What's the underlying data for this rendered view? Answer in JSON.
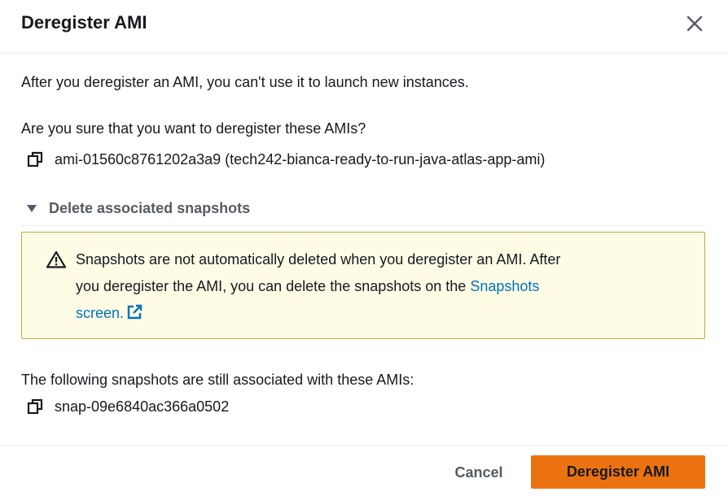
{
  "modal": {
    "title": "Deregister AMI",
    "close_icon": "close-icon"
  },
  "body": {
    "intro": "After you deregister an AMI, you can't use it to launch new instances.",
    "confirm_question": "Are you sure that you want to deregister these AMIs?",
    "ami_entry": "ami-01560c8761202a3a9 (tech242-bianca-ready-to-run-java-atlas-app-ami)",
    "copy_icon": "copy-icon"
  },
  "expandable": {
    "label": "Delete associated snapshots",
    "expanded": true,
    "caret_icon": "caret-down-icon"
  },
  "alert": {
    "type": "warning",
    "icon": "warning-icon",
    "text_line1": "Snapshots are not automatically deleted when you deregister an AMI. After",
    "text_line2_prefix": "you deregister the AMI, you can delete the snapshots on the",
    "link_text_part1": "Snapshots",
    "link_text_part2": "screen.",
    "external_link_icon": "external-link-icon"
  },
  "snapshots": {
    "heading": "The following snapshots are still associated with these AMIs:",
    "items": [
      "snap-09e6840ac366a0502"
    ]
  },
  "footer": {
    "cancel_label": "Cancel",
    "primary_label": "Deregister AMI"
  },
  "colors": {
    "primary_button": "#ec7211",
    "link": "#0073bb",
    "alert_background": "#fffce6",
    "alert_border": "#c5a83a",
    "secondary_text": "#545b64"
  }
}
